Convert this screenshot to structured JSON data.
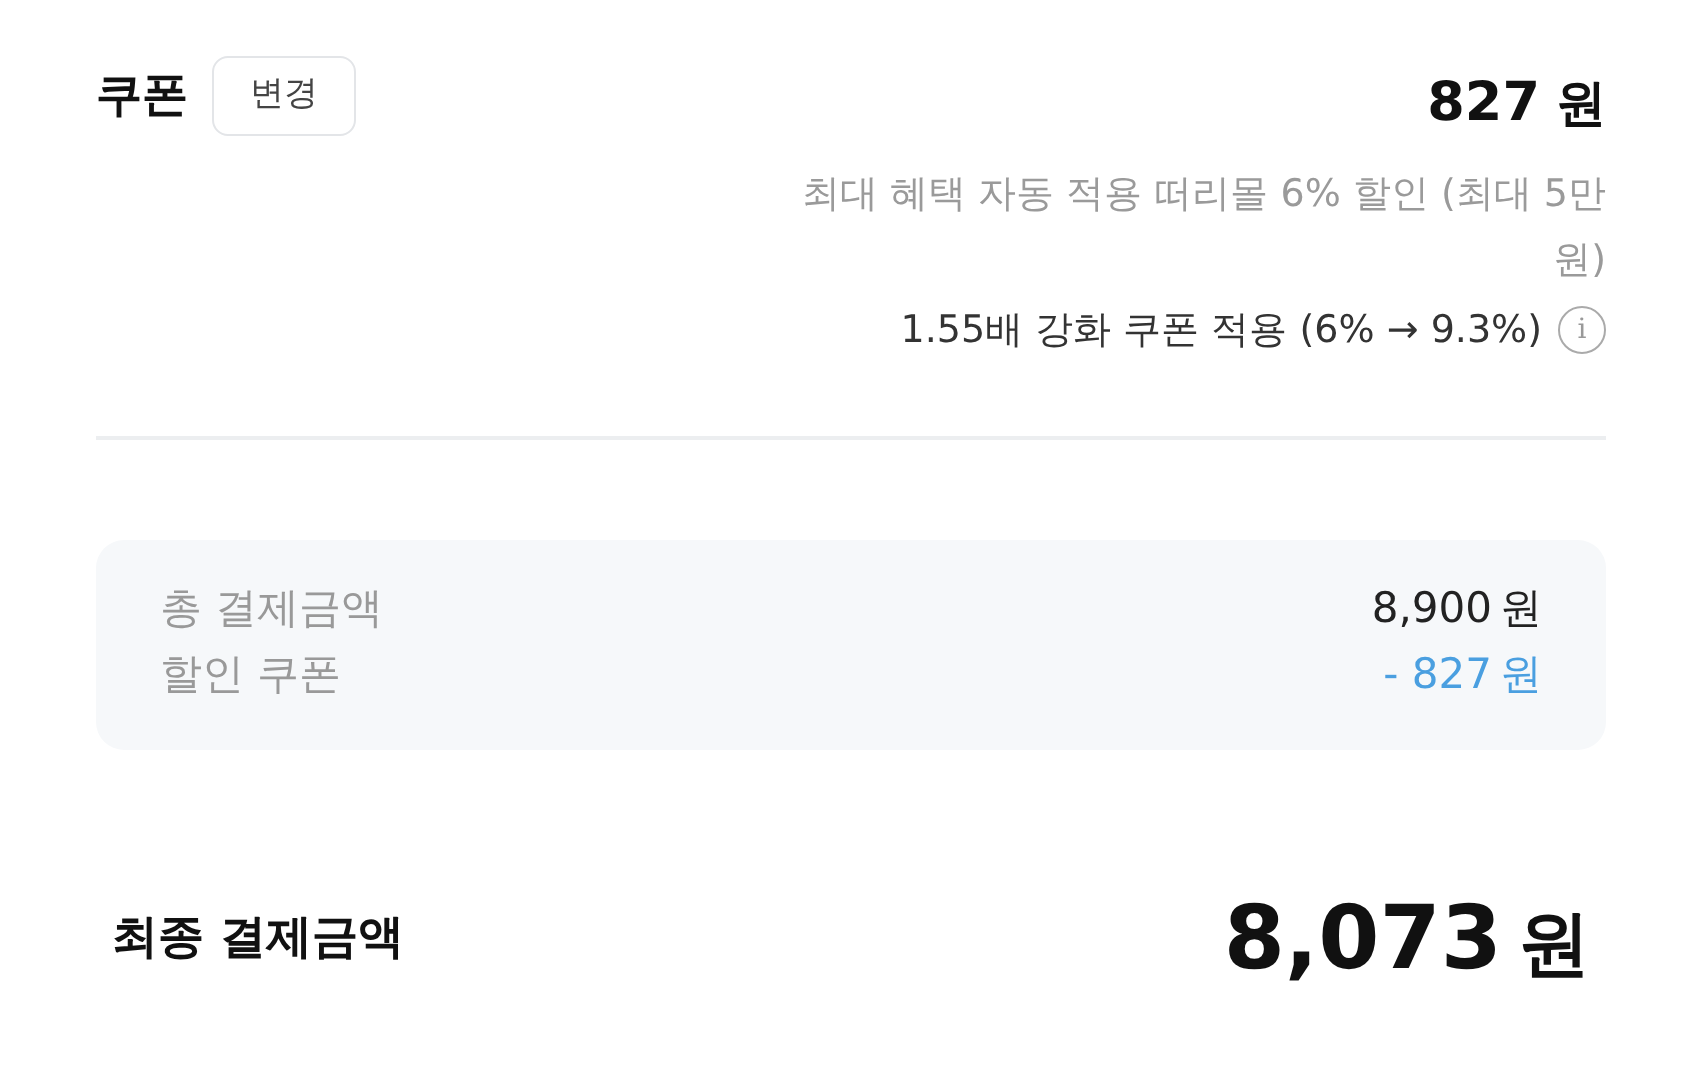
{
  "coupon": {
    "title": "쿠폰",
    "change_button": "변경",
    "amount": "827",
    "unit": "원",
    "note": "최대 혜택 자동 적용 떠리몰 6% 할인 (최대 5만 원)",
    "boost": "1.55배 강화 쿠폰 적용 (6% → 9.3%)",
    "info_icon": "i"
  },
  "summary": [
    {
      "label": "총 결제금액",
      "amount": "8,900",
      "unit": "원",
      "kind": "total"
    },
    {
      "label": "할인 쿠폰",
      "amount": "- 827",
      "unit": "원",
      "kind": "discount"
    }
  ],
  "final": {
    "label": "최종 결제금액",
    "amount": "8,073",
    "unit": "원"
  }
}
